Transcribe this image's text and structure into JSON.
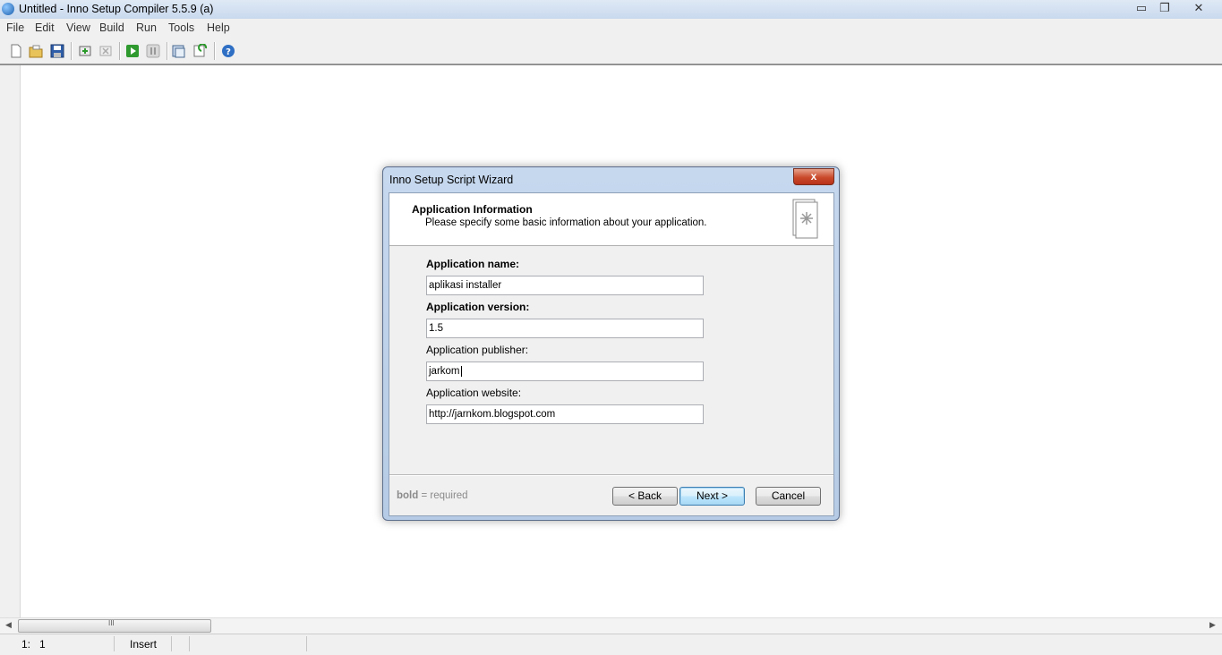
{
  "window": {
    "title": "Untitled - Inno Setup Compiler 5.5.9 (a)",
    "minimize_glyph": "▭",
    "restore_glyph": "❐",
    "close_glyph": "✕"
  },
  "menu": [
    "File",
    "Edit",
    "View",
    "Build",
    "Run",
    "Tools",
    "Help"
  ],
  "toolbar_icons": [
    "new-file-icon",
    "open-folder-icon",
    "save-icon",
    "compile-icon",
    "stop-compile-icon",
    "run-icon",
    "pause-icon",
    "target-setup-icon",
    "refresh-icon",
    "help-icon"
  ],
  "status": {
    "position": "1:   1",
    "mode": "Insert"
  },
  "wizard": {
    "title": "Inno Setup Script Wizard",
    "close_label": "x",
    "header_title": "Application Information",
    "header_subtitle": "Please specify some basic information about your application.",
    "fields": [
      {
        "label": "Application name:",
        "value": "aplikasi installer",
        "required": true
      },
      {
        "label": "Application version:",
        "value": "1.5",
        "required": true
      },
      {
        "label": "Application publisher:",
        "value": "jarkom",
        "required": false
      },
      {
        "label": "Application website:",
        "value": "http://jarnkom.blogspot.com",
        "required": false
      }
    ],
    "required_note_bold": "bold",
    "required_note_rest": " = required",
    "buttons": {
      "back": "< Back",
      "next": "Next >",
      "cancel": "Cancel"
    }
  },
  "scroll": {
    "left_arrow": "◀",
    "right_arrow": "▶",
    "grip": "III"
  }
}
